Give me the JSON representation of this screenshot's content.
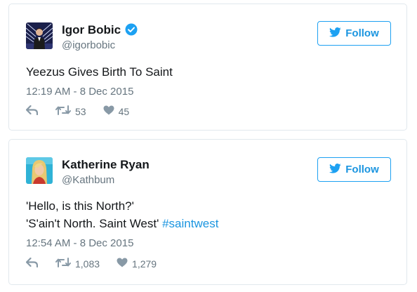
{
  "tweets": [
    {
      "display_name": "Igor Bobic",
      "verified": true,
      "handle": "@igorbobic",
      "follow_label": "Follow",
      "text_lines": [
        "Yeezus Gives Birth To Saint"
      ],
      "timestamp": "12:19 AM - 8 Dec 2015",
      "retweets": "53",
      "likes": "45"
    },
    {
      "display_name": "Katherine Ryan",
      "verified": false,
      "handle": "@Kathbum",
      "follow_label": "Follow",
      "text_lines": [
        "'Hello, is this North?'",
        "'S'ain't North. Saint West' "
      ],
      "hashtag": "#saintwest",
      "timestamp": "12:54 AM - 8 Dec 2015",
      "retweets": "1,083",
      "likes": "1,279"
    }
  ],
  "icons": {
    "verified": "verified-badge-icon",
    "bird": "twitter-bird-icon",
    "reply": "reply-arrow-icon",
    "retweet": "retweet-icon",
    "like": "heart-icon"
  },
  "colors": {
    "twitter_blue": "#1da1f2",
    "link_blue": "#1b95e0",
    "muted_text": "#66757f",
    "icon_gray": "#8899a6",
    "border": "#e1e8ed"
  }
}
